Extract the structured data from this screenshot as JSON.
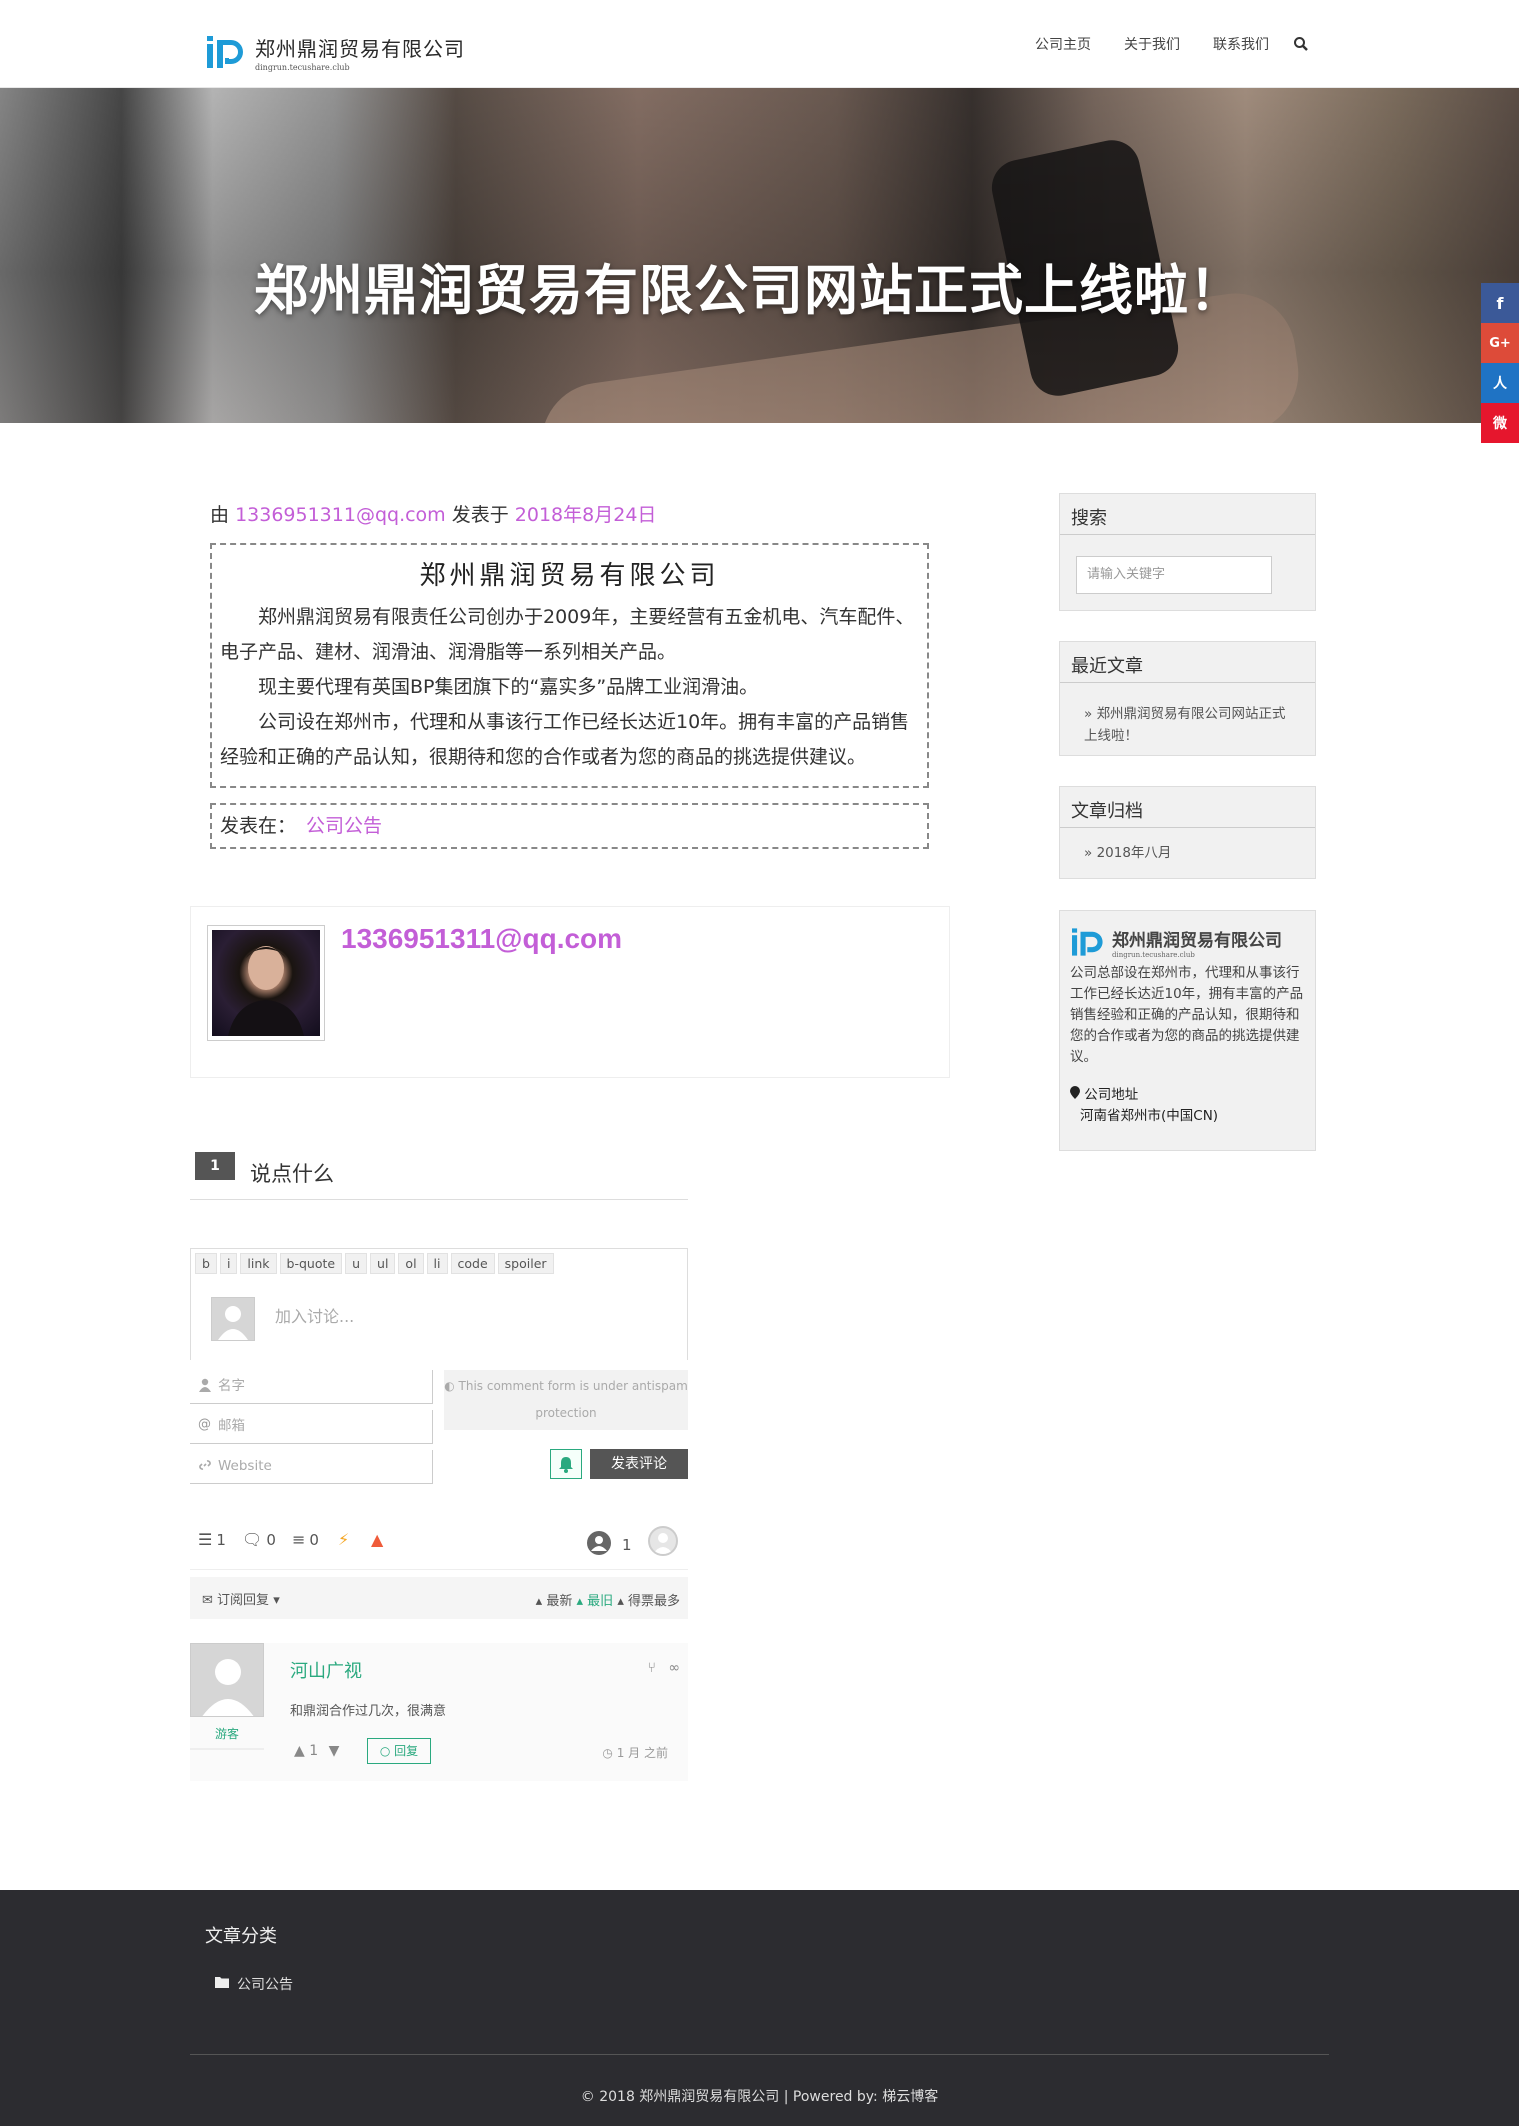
{
  "header": {
    "logo_name": "郑州鼎润贸易有限公司",
    "logo_domain": "dingrun.tecushare.club",
    "nav": [
      "公司主页",
      "关于我们",
      "联系我们"
    ],
    "search_icon": "search-icon"
  },
  "hero": {
    "title": "郑州鼎润贸易有限公司网站正式上线啦！"
  },
  "social": {
    "items": [
      "facebook",
      "google-plus",
      "renren",
      "weibo"
    ],
    "colors": [
      "#3b5998",
      "#dd4b39",
      "#1f73c4",
      "#e6162d"
    ],
    "glyphs": [
      "f",
      "G+",
      "人",
      "微"
    ]
  },
  "post": {
    "meta_prefix": "由",
    "author": "1336951311@qq.com",
    "meta_mid": "发表于",
    "date": "2018年8月24日",
    "company_title": "郑州鼎润贸易有限公司",
    "para1": "郑州鼎润贸易有限责任公司创办于2009年，主要经营有五金机电、汽车配件、电子产品、建材、润滑油、润滑脂等一系列相关产品。",
    "para2": "现主要代理有英国BP集团旗下的“嘉实多”品牌工业润滑油。",
    "para3": "公司设在郑州市，代理和从事该行工作已经长达近10年。拥有丰富的产品销售经验和正确的产品认知，很期待和您的合作或者为您的商品的挑选提供建议。",
    "posted_in_label": "发表在：",
    "category": "公司公告"
  },
  "author_box": {
    "name": "1336951311@qq.com"
  },
  "comments": {
    "count": "1",
    "title": "说点什么",
    "toolbar": [
      "b",
      "i",
      "link",
      "b-quote",
      "u",
      "ul",
      "ol",
      "li",
      "code",
      "spoiler"
    ],
    "editor_placeholder": "加入讨论...",
    "name_placeholder": "名字",
    "email_placeholder": "邮箱",
    "website_placeholder": "Website",
    "antispam_line1": "This comment form is under antispam",
    "antispam_line2": "protection",
    "submit_label": "发表评论",
    "stats": {
      "threads": "1",
      "replies": "0",
      "followers": "0",
      "authors": "1"
    },
    "subscribe_label": "订阅回复",
    "sort_newest": "最新",
    "sort_oldest": "最旧",
    "sort_most_voted": "得票最多",
    "item": {
      "author": "河山广视",
      "badge": "游客",
      "text": "和鼎润合作过几次，很满意",
      "votes": "1",
      "reply_label": "回复",
      "time": "1 月 之前"
    }
  },
  "sidebar": {
    "search_title": "搜索",
    "search_placeholder": "请输入关键字",
    "recent_title": "最近文章",
    "recent_item": "郑州鼎润贸易有限公司网站正式上线啦！",
    "archive_title": "文章归档",
    "archive_item": "2018年八月",
    "about_name": "郑州鼎润贸易有限公司",
    "about_domain": "dingrun.tecushare.club",
    "about_text": "公司总部设在郑州市，代理和从事该行工作已经长达近10年，拥有丰富的产品销售经验和正确的产品认知，很期待和您的合作或者为您的商品的挑选提供建议。",
    "address_label": "公司地址",
    "address": "河南省郑州市(中国CN)"
  },
  "footer": {
    "title": "文章分类",
    "category": "公司公告",
    "copyright_prefix": "© 2018 郑州鼎润贸易有限公司 | Powered by: ",
    "powered_by": "梯云博客"
  },
  "colors": {
    "link": "#c35ed7",
    "accent": "#2aa97f",
    "footer_bg": "#2c2c30"
  }
}
